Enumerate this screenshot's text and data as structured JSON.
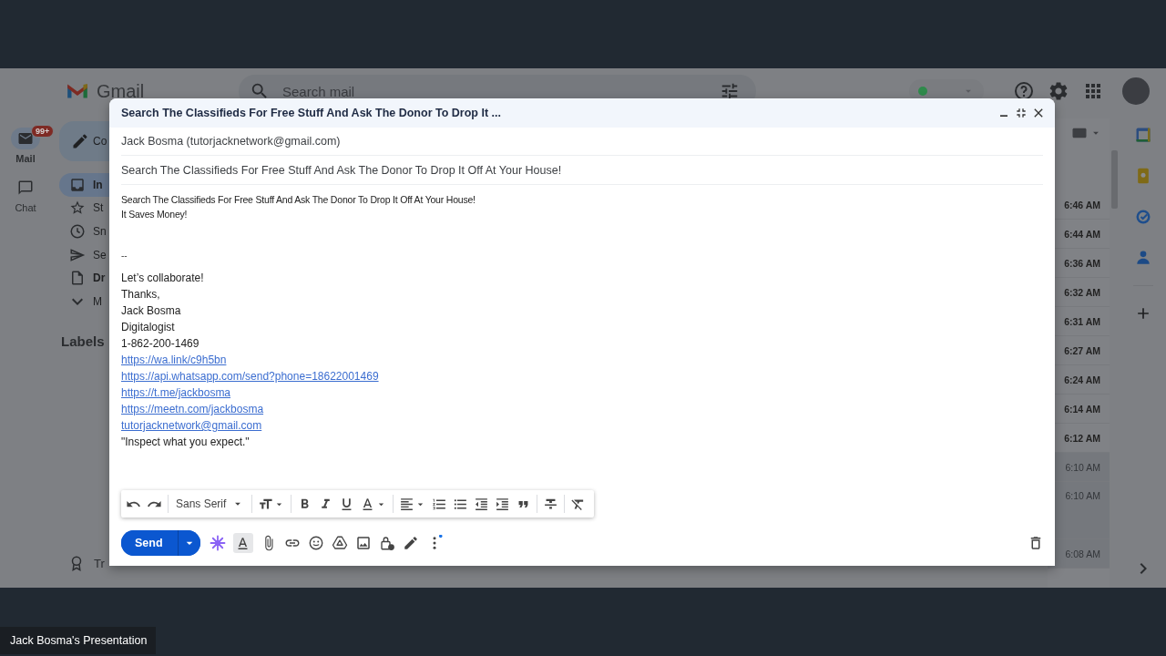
{
  "gmail": {
    "logo_text": "Gmail",
    "search": {
      "placeholder": "Search mail"
    },
    "rail": [
      {
        "kind": "mail",
        "label": "Mail",
        "badge": "99+",
        "selected": true
      },
      {
        "kind": "chat",
        "label": "Chat",
        "selected": false
      }
    ],
    "compose_button": "Co",
    "nav": [
      {
        "kind": "inbox",
        "label": "In",
        "selected": true,
        "unread": true
      },
      {
        "kind": "starred",
        "label": "St",
        "selected": false,
        "unread": false
      },
      {
        "kind": "snoozed",
        "label": "Sn",
        "selected": false,
        "unread": false
      },
      {
        "kind": "sent",
        "label": "Se",
        "selected": false,
        "unread": false
      },
      {
        "kind": "drafts",
        "label": "Dr",
        "selected": false,
        "unread": true
      },
      {
        "kind": "more",
        "label": "M",
        "selected": false,
        "unread": false
      }
    ],
    "labels_heading": "Labels",
    "promo": "Tr",
    "times": [
      {
        "text": "6:46 AM",
        "unread": true
      },
      {
        "text": "6:44 AM",
        "unread": true
      },
      {
        "text": "6:36 AM",
        "unread": true
      },
      {
        "text": "6:32 AM",
        "unread": true
      },
      {
        "text": "6:31 AM",
        "unread": true
      },
      {
        "text": "6:27 AM",
        "unread": true
      },
      {
        "text": "6:24 AM",
        "unread": true
      },
      {
        "text": "6:14 AM",
        "unread": true
      },
      {
        "text": "6:12 AM",
        "unread": true
      },
      {
        "text": "6:10 AM",
        "unread": false
      },
      {
        "text": "6:10 AM",
        "unread": false
      },
      {
        "text": "6:08 AM",
        "unread": false
      }
    ]
  },
  "compose": {
    "title": "Search The Classifieds For Free Stuff And Ask The Donor To Drop It ...",
    "from": "Jack Bosma (tutorjacknetwork@gmail.com)",
    "subject": "Search The Classifieds For Free Stuff And Ask The Donor To Drop It Off At Your House!",
    "body": [
      {
        "kind": "lead",
        "text": "Search The Classifieds For Free Stuff And Ask The Donor To Drop It Off At Your House!"
      },
      {
        "kind": "lead",
        "text": "It Saves Money!"
      },
      {
        "kind": "separator",
        "text": "--"
      },
      {
        "kind": "text",
        "text": "Let’s collaborate!"
      },
      {
        "kind": "text",
        "text": "Thanks,"
      },
      {
        "kind": "text",
        "text": "Jack Bosma"
      },
      {
        "kind": "text",
        "text": "Digitalogist"
      },
      {
        "kind": "text",
        "text": "1-862-200-1469"
      },
      {
        "kind": "link",
        "text": "https://wa.link/c9h5bn"
      },
      {
        "kind": "link",
        "text": "https://api.whatsapp.com/send?phone=18622001469"
      },
      {
        "kind": "link",
        "text": "https://t.me/jackbosma"
      },
      {
        "kind": "link",
        "text": "https://meetn.com/jackbosma"
      },
      {
        "kind": "link",
        "text": "tutorjacknetwork@gmail.com"
      },
      {
        "kind": "text",
        "text": "\"Inspect what you expect.\""
      }
    ],
    "font": "Sans Serif",
    "formatting_toggle": {
      "on": true
    },
    "send": "Send"
  },
  "presenter_label": "Jack Bosma's Presentation"
}
